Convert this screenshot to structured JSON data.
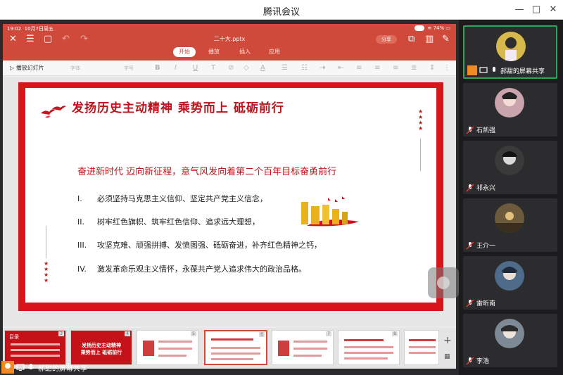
{
  "window": {
    "title": "腾讯会议",
    "minimize": "—",
    "maximize": "□",
    "close": "✕"
  },
  "tablet": {
    "time": "19:02",
    "date": "10月7日周五",
    "battery": "74%",
    "doc_title": "二十大.pptx",
    "share_label": "分享",
    "tabs": [
      {
        "label": "开始",
        "active": true
      },
      {
        "label": "播放",
        "active": false
      },
      {
        "label": "插入",
        "active": false
      },
      {
        "label": "应用",
        "active": false
      }
    ],
    "play_label": "播放幻灯片",
    "font_label": "字体",
    "size_label": "字号"
  },
  "slide": {
    "title": "发扬历史主动精神  乘势而上  砥砺前行",
    "subtitle": "奋进新时代  迈向新征程，意气风发向着第二个百年目标奋勇前行",
    "items": [
      {
        "num": "I.",
        "text": "必须坚持马克思主义信仰、坚定共产党主义信念，"
      },
      {
        "num": "II.",
        "text": "树牢红色旗帜、筑牢红色信仰、追求远大理想，"
      },
      {
        "num": "III.",
        "text": "攻坚克难、顽强拼搏、发愤图强、砥砺奋进，补齐红色精神之钙，"
      },
      {
        "num": "IV.",
        "text": "激发革命乐观主义情怀，永葆共产党人追求伟大的政治品格。"
      }
    ]
  },
  "thumbnails": [
    {
      "num": "3",
      "label": "目录"
    },
    {
      "num": "4",
      "line1": "发扬历史主动精神",
      "line2": "乘势而上 砥砺前行"
    },
    {
      "num": "5"
    },
    {
      "num": "6"
    },
    {
      "num": "7"
    },
    {
      "num": "8"
    }
  ],
  "thumb_add": "+",
  "thumb_grid": "▦",
  "sharer_label": "郝甜的屏幕共享",
  "participants": [
    {
      "name": "郝甜的屏幕共享",
      "color": "#d6b94a",
      "active": true
    },
    {
      "name": "石凯强",
      "color": "#c9a4ad",
      "active": false
    },
    {
      "name": "祁永兴",
      "color": "#3a3a3a",
      "active": false
    },
    {
      "name": "王介一",
      "color": "#6b5a3c",
      "active": false
    },
    {
      "name": "雷昕南",
      "color": "#4f6b8a",
      "active": false
    },
    {
      "name": "李浩",
      "color": "#7d8a96",
      "active": false
    }
  ]
}
